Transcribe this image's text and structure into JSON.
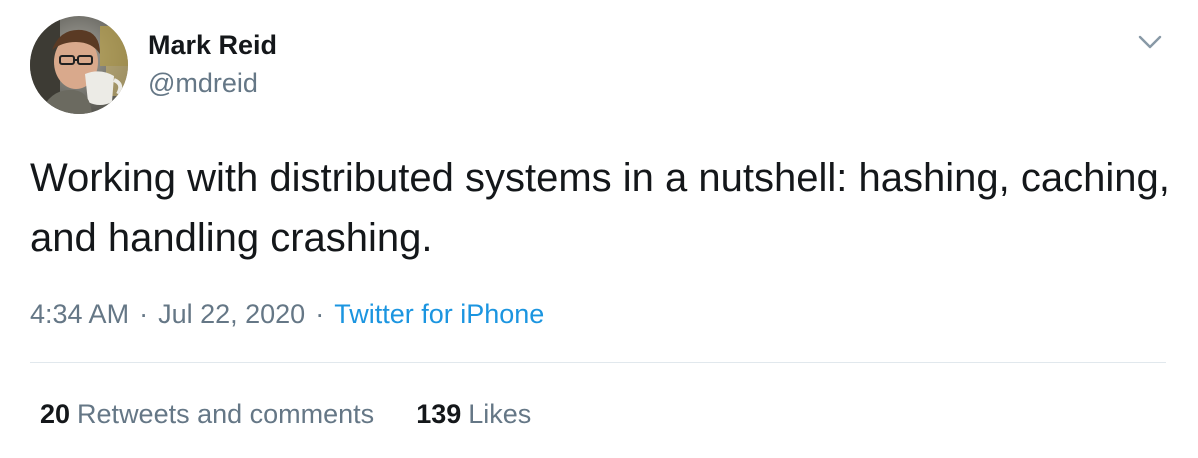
{
  "author": {
    "display_name": "Mark Reid",
    "handle": "@mdreid",
    "avatar_icon": "profile-photo"
  },
  "tweet": {
    "text": "Working with distributed systems in a nutshell: hashing, caching, and handling crashing.",
    "time": "4:34 AM",
    "date": "Jul 22, 2020",
    "separator": "·",
    "source": "Twitter for iPhone"
  },
  "stats": {
    "retweets_count": "20",
    "retweets_label": "Retweets and comments",
    "likes_count": "139",
    "likes_label": "Likes"
  },
  "menu": {
    "icon": "chevron-down-icon"
  },
  "colors": {
    "text": "#14171a",
    "secondary": "#657786",
    "link": "#1b95e0",
    "divider": "#e1e8ed"
  }
}
